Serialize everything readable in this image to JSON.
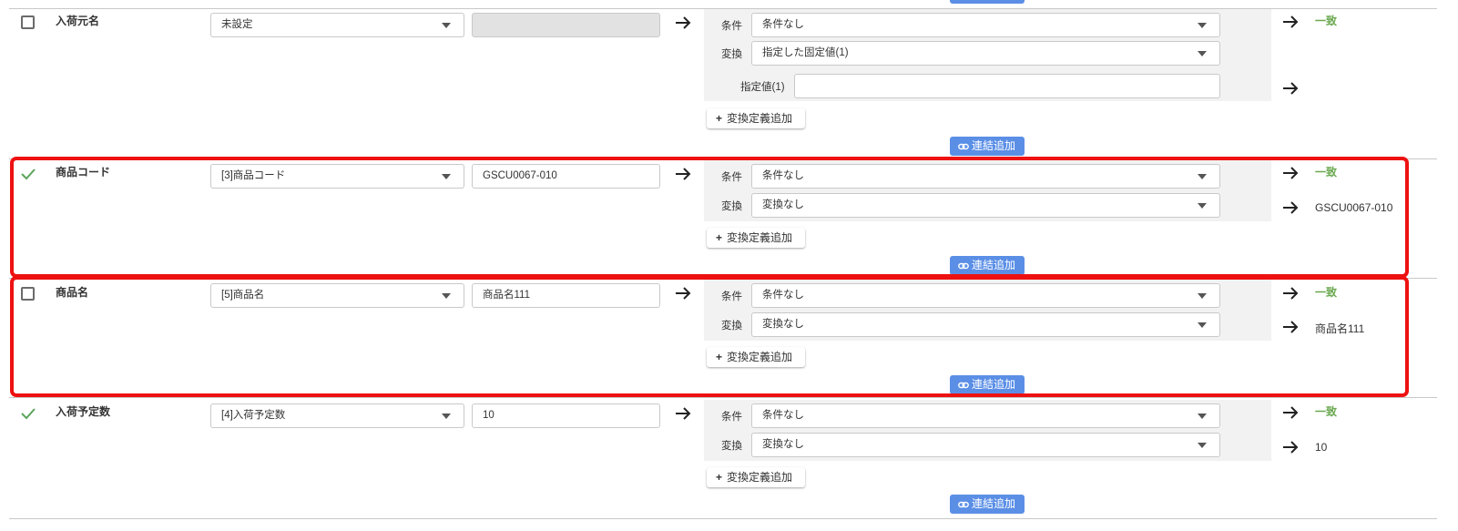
{
  "top_partial": {
    "link_label": "連結追加"
  },
  "rows": [
    {
      "checked": false,
      "field_name": "入荷元名",
      "source_select": "未設定",
      "source_value": "",
      "condition_label": "条件",
      "condition_value": "条件なし",
      "convert_label": "変換",
      "convert_value": "指定した固定値(1)",
      "extra_label": "指定値(1)",
      "extra_value": "",
      "add_def_label": "変換定義追加",
      "link_label": "連結追加",
      "match_text": "一致",
      "result_text": ""
    },
    {
      "checked": true,
      "field_name": "商品コード",
      "source_select": "[3]商品コード",
      "source_value": "GSCU0067-010",
      "condition_label": "条件",
      "condition_value": "条件なし",
      "convert_label": "変換",
      "convert_value": "変換なし",
      "add_def_label": "変換定義追加",
      "link_label": "連結追加",
      "match_text": "一致",
      "result_text": "GSCU0067-010"
    },
    {
      "checked": false,
      "field_name": "商品名",
      "source_select": "[5]商品名",
      "source_value": "商品名111",
      "condition_label": "条件",
      "condition_value": "条件なし",
      "convert_label": "変換",
      "convert_value": "変換なし",
      "add_def_label": "変換定義追加",
      "link_label": "連結追加",
      "match_text": "一致",
      "result_text": "商品名111"
    },
    {
      "checked": true,
      "field_name": "入荷予定数",
      "source_select": "[4]入荷予定数",
      "source_value": "10",
      "condition_label": "条件",
      "condition_value": "条件なし",
      "convert_label": "変換",
      "convert_value": "変換なし",
      "add_def_label": "変換定義追加",
      "link_label": "連結追加",
      "match_text": "一致",
      "result_text": "10"
    }
  ],
  "colors": {
    "highlight": "#ee1111",
    "link_button": "#5b8fe6",
    "match_text": "#6aa84f",
    "check_mark": "#5aa55a"
  },
  "icons": [
    "checkbox-icon",
    "check-mark-icon",
    "arrow-right-icon",
    "plus-icon",
    "link-icon",
    "caret-down-icon"
  ]
}
